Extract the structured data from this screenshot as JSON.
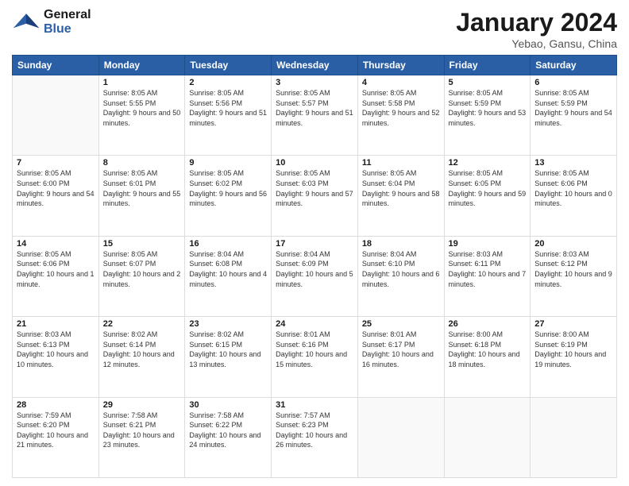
{
  "header": {
    "logo": {
      "general": "General",
      "blue": "Blue"
    },
    "title": "January 2024",
    "subtitle": "Yebao, Gansu, China"
  },
  "days_of_week": [
    "Sunday",
    "Monday",
    "Tuesday",
    "Wednesday",
    "Thursday",
    "Friday",
    "Saturday"
  ],
  "weeks": [
    [
      {
        "day": "",
        "sunrise": "",
        "sunset": "",
        "daylight": ""
      },
      {
        "day": "1",
        "sunrise": "Sunrise: 8:05 AM",
        "sunset": "Sunset: 5:55 PM",
        "daylight": "Daylight: 9 hours and 50 minutes."
      },
      {
        "day": "2",
        "sunrise": "Sunrise: 8:05 AM",
        "sunset": "Sunset: 5:56 PM",
        "daylight": "Daylight: 9 hours and 51 minutes."
      },
      {
        "day": "3",
        "sunrise": "Sunrise: 8:05 AM",
        "sunset": "Sunset: 5:57 PM",
        "daylight": "Daylight: 9 hours and 51 minutes."
      },
      {
        "day": "4",
        "sunrise": "Sunrise: 8:05 AM",
        "sunset": "Sunset: 5:58 PM",
        "daylight": "Daylight: 9 hours and 52 minutes."
      },
      {
        "day": "5",
        "sunrise": "Sunrise: 8:05 AM",
        "sunset": "Sunset: 5:59 PM",
        "daylight": "Daylight: 9 hours and 53 minutes."
      },
      {
        "day": "6",
        "sunrise": "Sunrise: 8:05 AM",
        "sunset": "Sunset: 5:59 PM",
        "daylight": "Daylight: 9 hours and 54 minutes."
      }
    ],
    [
      {
        "day": "7",
        "sunrise": "Sunrise: 8:05 AM",
        "sunset": "Sunset: 6:00 PM",
        "daylight": "Daylight: 9 hours and 54 minutes."
      },
      {
        "day": "8",
        "sunrise": "Sunrise: 8:05 AM",
        "sunset": "Sunset: 6:01 PM",
        "daylight": "Daylight: 9 hours and 55 minutes."
      },
      {
        "day": "9",
        "sunrise": "Sunrise: 8:05 AM",
        "sunset": "Sunset: 6:02 PM",
        "daylight": "Daylight: 9 hours and 56 minutes."
      },
      {
        "day": "10",
        "sunrise": "Sunrise: 8:05 AM",
        "sunset": "Sunset: 6:03 PM",
        "daylight": "Daylight: 9 hours and 57 minutes."
      },
      {
        "day": "11",
        "sunrise": "Sunrise: 8:05 AM",
        "sunset": "Sunset: 6:04 PM",
        "daylight": "Daylight: 9 hours and 58 minutes."
      },
      {
        "day": "12",
        "sunrise": "Sunrise: 8:05 AM",
        "sunset": "Sunset: 6:05 PM",
        "daylight": "Daylight: 9 hours and 59 minutes."
      },
      {
        "day": "13",
        "sunrise": "Sunrise: 8:05 AM",
        "sunset": "Sunset: 6:06 PM",
        "daylight": "Daylight: 10 hours and 0 minutes."
      }
    ],
    [
      {
        "day": "14",
        "sunrise": "Sunrise: 8:05 AM",
        "sunset": "Sunset: 6:06 PM",
        "daylight": "Daylight: 10 hours and 1 minute."
      },
      {
        "day": "15",
        "sunrise": "Sunrise: 8:05 AM",
        "sunset": "Sunset: 6:07 PM",
        "daylight": "Daylight: 10 hours and 2 minutes."
      },
      {
        "day": "16",
        "sunrise": "Sunrise: 8:04 AM",
        "sunset": "Sunset: 6:08 PM",
        "daylight": "Daylight: 10 hours and 4 minutes."
      },
      {
        "day": "17",
        "sunrise": "Sunrise: 8:04 AM",
        "sunset": "Sunset: 6:09 PM",
        "daylight": "Daylight: 10 hours and 5 minutes."
      },
      {
        "day": "18",
        "sunrise": "Sunrise: 8:04 AM",
        "sunset": "Sunset: 6:10 PM",
        "daylight": "Daylight: 10 hours and 6 minutes."
      },
      {
        "day": "19",
        "sunrise": "Sunrise: 8:03 AM",
        "sunset": "Sunset: 6:11 PM",
        "daylight": "Daylight: 10 hours and 7 minutes."
      },
      {
        "day": "20",
        "sunrise": "Sunrise: 8:03 AM",
        "sunset": "Sunset: 6:12 PM",
        "daylight": "Daylight: 10 hours and 9 minutes."
      }
    ],
    [
      {
        "day": "21",
        "sunrise": "Sunrise: 8:03 AM",
        "sunset": "Sunset: 6:13 PM",
        "daylight": "Daylight: 10 hours and 10 minutes."
      },
      {
        "day": "22",
        "sunrise": "Sunrise: 8:02 AM",
        "sunset": "Sunset: 6:14 PM",
        "daylight": "Daylight: 10 hours and 12 minutes."
      },
      {
        "day": "23",
        "sunrise": "Sunrise: 8:02 AM",
        "sunset": "Sunset: 6:15 PM",
        "daylight": "Daylight: 10 hours and 13 minutes."
      },
      {
        "day": "24",
        "sunrise": "Sunrise: 8:01 AM",
        "sunset": "Sunset: 6:16 PM",
        "daylight": "Daylight: 10 hours and 15 minutes."
      },
      {
        "day": "25",
        "sunrise": "Sunrise: 8:01 AM",
        "sunset": "Sunset: 6:17 PM",
        "daylight": "Daylight: 10 hours and 16 minutes."
      },
      {
        "day": "26",
        "sunrise": "Sunrise: 8:00 AM",
        "sunset": "Sunset: 6:18 PM",
        "daylight": "Daylight: 10 hours and 18 minutes."
      },
      {
        "day": "27",
        "sunrise": "Sunrise: 8:00 AM",
        "sunset": "Sunset: 6:19 PM",
        "daylight": "Daylight: 10 hours and 19 minutes."
      }
    ],
    [
      {
        "day": "28",
        "sunrise": "Sunrise: 7:59 AM",
        "sunset": "Sunset: 6:20 PM",
        "daylight": "Daylight: 10 hours and 21 minutes."
      },
      {
        "day": "29",
        "sunrise": "Sunrise: 7:58 AM",
        "sunset": "Sunset: 6:21 PM",
        "daylight": "Daylight: 10 hours and 23 minutes."
      },
      {
        "day": "30",
        "sunrise": "Sunrise: 7:58 AM",
        "sunset": "Sunset: 6:22 PM",
        "daylight": "Daylight: 10 hours and 24 minutes."
      },
      {
        "day": "31",
        "sunrise": "Sunrise: 7:57 AM",
        "sunset": "Sunset: 6:23 PM",
        "daylight": "Daylight: 10 hours and 26 minutes."
      },
      {
        "day": "",
        "sunrise": "",
        "sunset": "",
        "daylight": ""
      },
      {
        "day": "",
        "sunrise": "",
        "sunset": "",
        "daylight": ""
      },
      {
        "day": "",
        "sunrise": "",
        "sunset": "",
        "daylight": ""
      }
    ]
  ]
}
